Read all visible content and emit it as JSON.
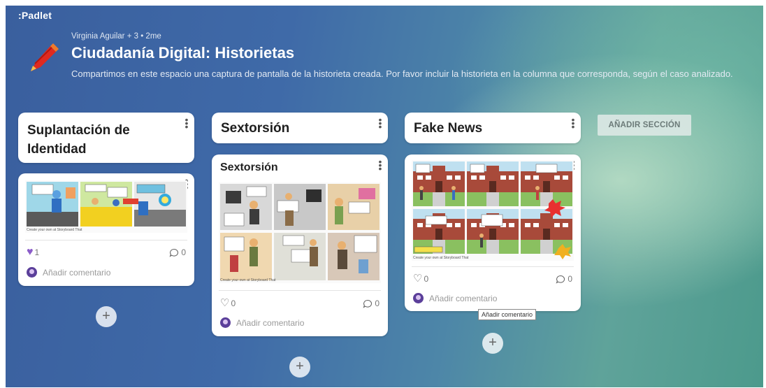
{
  "app": {
    "logo": ":Padlet"
  },
  "header": {
    "meta": "Virginia Aguilar + 3 • 2me",
    "title": "Ciudadanía Digital: Historietas",
    "description": "Compartimos en este espacio una captura de pantalla de la historieta creada. Por favor incluir la historieta en la columna que corresponda, según el caso analizado."
  },
  "columns": [
    {
      "heading": "Suplantación de Identidad",
      "post": {
        "title": "",
        "likes": "1",
        "comments": "0",
        "comment_placeholder": "Añadir comentario",
        "comic_credit": "Create your own at Storyboard That"
      }
    },
    {
      "heading": "Sextorsión",
      "post": {
        "title": "Sextorsión",
        "likes": "0",
        "comments": "0",
        "comment_placeholder": "Añadir comentario",
        "comic_credit": "Create your own at Storyboard That"
      }
    },
    {
      "heading": "Fake News",
      "post": {
        "title": "",
        "likes": "0",
        "comments": "0",
        "comment_placeholder": "Añadir comentario",
        "comic_credit": "Create your own at Storyboard That"
      }
    }
  ],
  "add_section_label": "AÑADIR SECCIÓN",
  "tooltip": "Añadir comentario",
  "add_post_symbol": "+",
  "colors": {
    "heart_filled": "#8b5cc9",
    "add_section_bg": "#dce8e4"
  }
}
